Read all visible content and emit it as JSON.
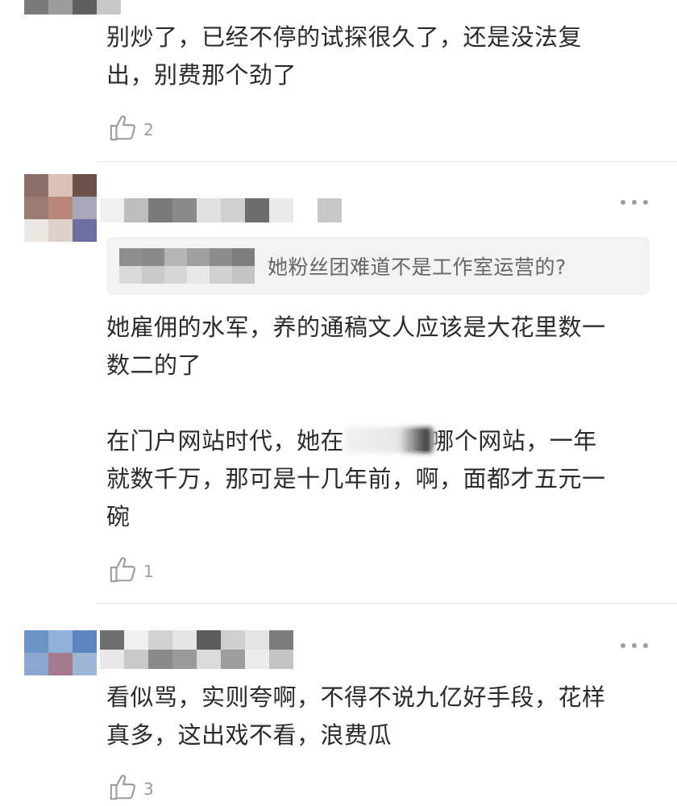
{
  "comments": [
    {
      "text": "别炒了，已经不停的试探很久了，还是没法复\n出，别费那个劲了",
      "likes": "2"
    },
    {
      "quote": "她粉丝团难道不是工作室运营的?",
      "text": "她雇佣的水军，养的通稿文人应该是大花里数一\n数二的了\n\n在门户网站时代，她在        是哪个网站，一年\n就数千万，那可是十几年前，啊，面都才五元一\n碗",
      "likes": "1"
    },
    {
      "text": "看似骂，实则夸啊，不得不说九亿好手段，花样\n真多，这出戏不看，浪费瓜",
      "likes": "3"
    }
  ],
  "icons": {
    "like": "thumbs-up-icon",
    "more": "more-dots-icon"
  },
  "colors": {
    "text": "#2b2b2b",
    "muted": "#9a9a9a",
    "quote_bg": "#f3f3f3",
    "divider": "#e4e4e4"
  }
}
